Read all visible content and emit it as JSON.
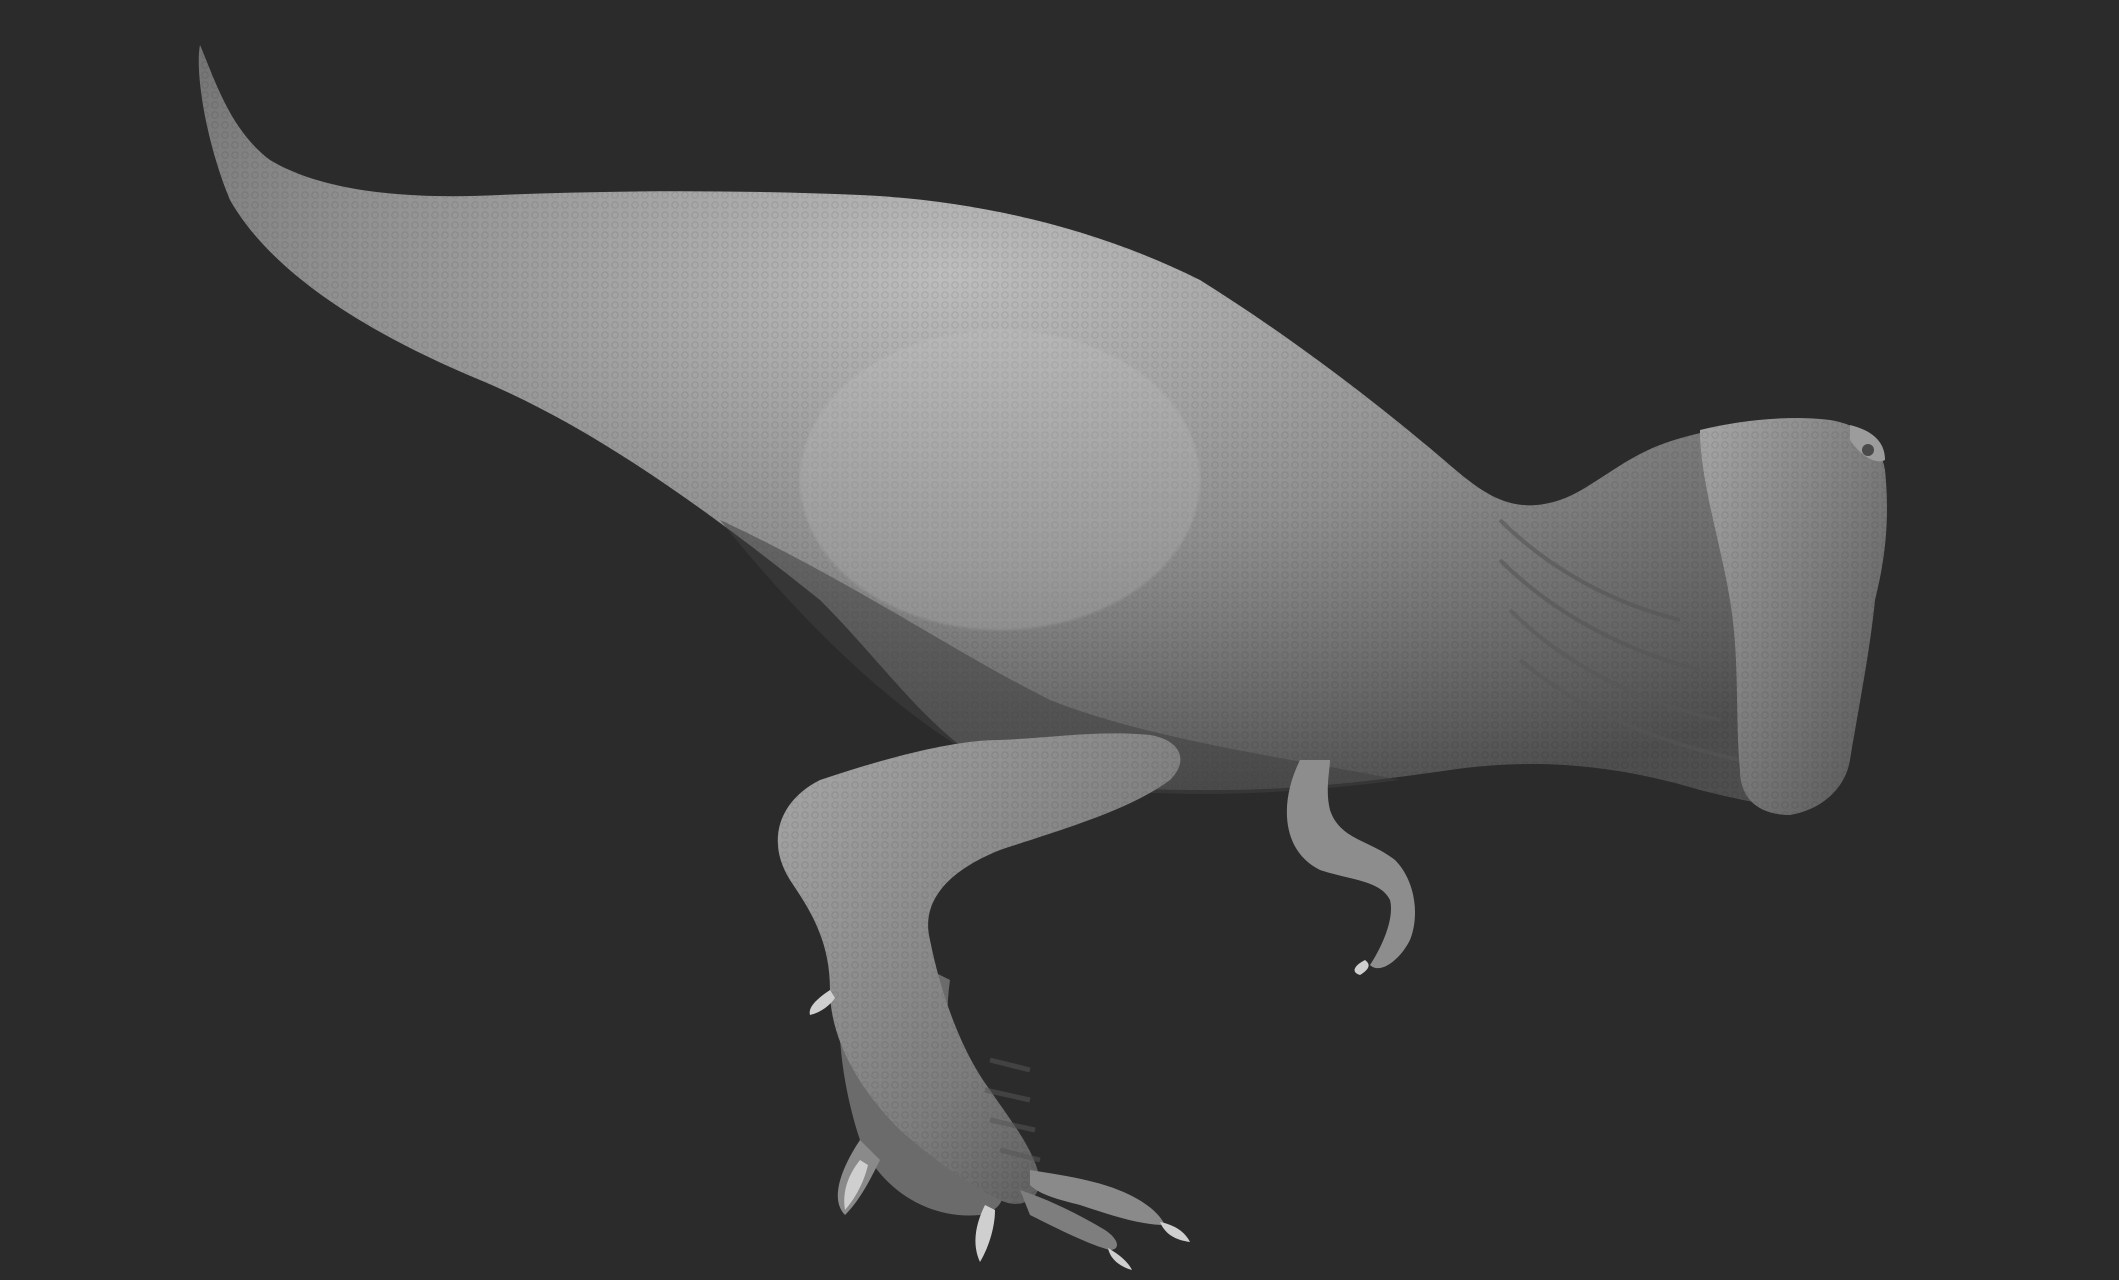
{
  "scene": {
    "subject_icon": "dinosaur-sculpt-icon",
    "colors": {
      "background": "#2b2b2b",
      "clay_light": "#b4b4b4",
      "clay_mid": "#8a8a8a",
      "clay_dark": "#565656",
      "shadow": "#3a3a3a"
    }
  }
}
